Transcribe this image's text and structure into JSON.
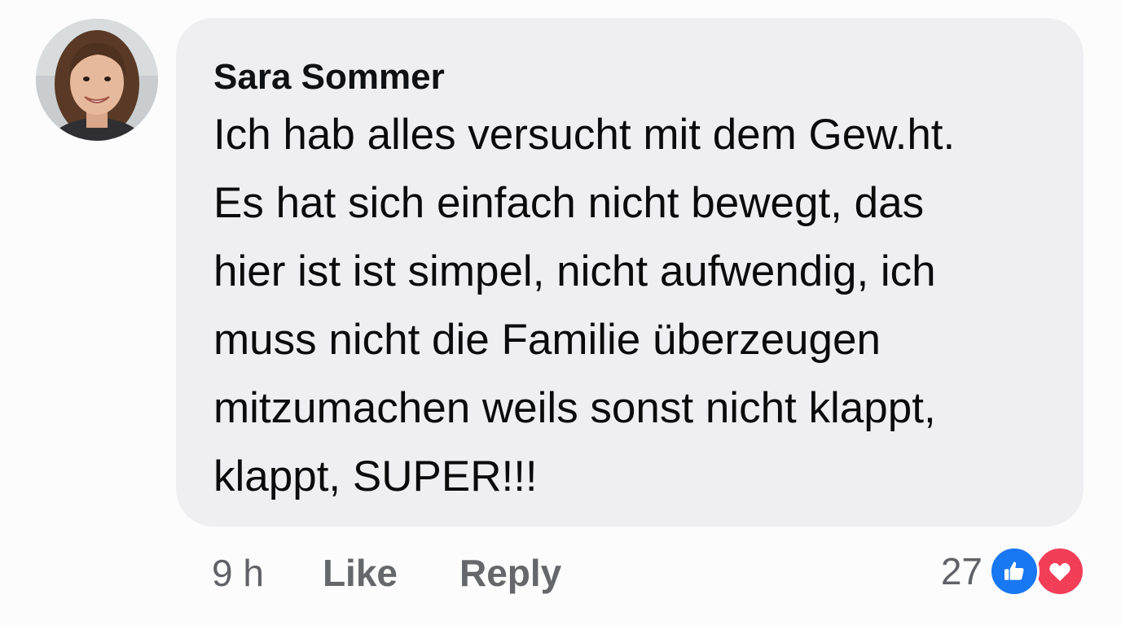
{
  "comment": {
    "author": "Sara Sommer",
    "text_lines": [
      "Ich hab alles versucht mit dem Gew.ht.",
      "Es hat sich einfach nicht bewegt, das",
      "hier ist ist simpel, nicht aufwendig, ich",
      "muss nicht die Familie überzeugen",
      "mitzumachen weils sonst nicht klappt,",
      "klappt, SUPER!!!"
    ],
    "timestamp": "9 h",
    "like_label": "Like",
    "reply_label": "Reply",
    "reaction_count": "27",
    "reactions": [
      "like-icon",
      "love-icon"
    ]
  },
  "colors": {
    "bubble": "#efeff1",
    "like_blue": "#1877f2",
    "love_red": "#f33e58",
    "meta_gray": "#65676b"
  }
}
